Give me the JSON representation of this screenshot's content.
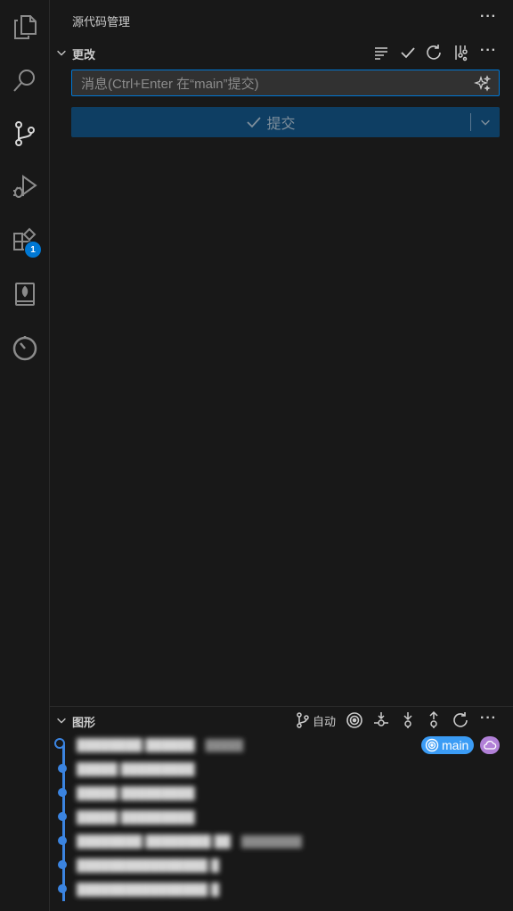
{
  "sidebar": {
    "title": "源代码管理",
    "changes": {
      "title": "更改",
      "message_placeholder": "消息(Ctrl+Enter 在“main”提交)",
      "message_value": "",
      "commit_label": "提交"
    },
    "graph": {
      "title": "图形",
      "auto_label": "自动",
      "branch_name": "main",
      "commits": [
        {
          "message": "████████ ██████",
          "author": "█████"
        },
        {
          "message": "█████ █████████",
          "author": ""
        },
        {
          "message": "█████ █████████",
          "author": ""
        },
        {
          "message": "█████ █████████",
          "author": ""
        },
        {
          "message": "████████ ████████ ██",
          "author": "████████"
        },
        {
          "message": "████████████████ █",
          "author": ""
        },
        {
          "message": "████████████████ █",
          "author": ""
        }
      ]
    }
  },
  "activity_bar": {
    "extensions_badge": "1",
    "items": [
      "explorer-icon",
      "search-icon",
      "source-control-icon",
      "run-debug-icon",
      "extensions-icon",
      "notebook-icon",
      "timeline-icon"
    ]
  },
  "colors": {
    "accent": "#0078d4",
    "commit_button_bg": "#0e3e63",
    "graph_lane": "#3b84e0",
    "branch_pill": "#3b9cf5",
    "remote_pill": "#b180d7"
  }
}
